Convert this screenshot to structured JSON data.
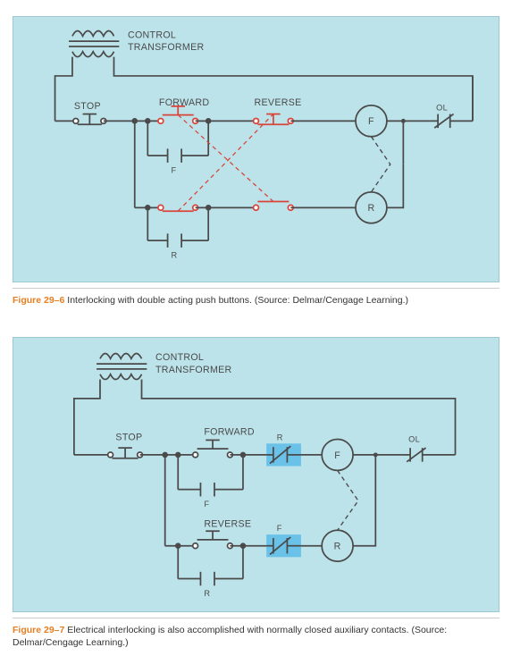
{
  "fig1": {
    "panel_bg": "#bce3ea",
    "transformer_label1": "CONTROL",
    "transformer_label2": "TRANSFORMER",
    "stop": "STOP",
    "forward": "FORWARD",
    "reverse": "REVERSE",
    "ol": "OL",
    "coil_f": "F",
    "coil_r": "R",
    "aux_f": "F",
    "aux_r": "R",
    "caption_no": "Figure 29–6",
    "caption_text": " Interlocking with double acting push buttons. (Source: Delmar/Cengage Learning.)"
  },
  "fig2": {
    "transformer_label1": "CONTROL",
    "transformer_label2": "TRANSFORMER",
    "stop": "STOP",
    "forward": "FORWARD",
    "reverse": "REVERSE",
    "ol": "OL",
    "coil_f": "F",
    "coil_r": "R",
    "aux_f": "F",
    "aux_r": "R",
    "nc_r": "R",
    "nc_f": "F",
    "caption_no": "Figure 29–7",
    "caption_text": " Electrical interlocking is also accomplished with normally closed auxiliary contacts. (Source: Delmar/Cengage Learning.)"
  },
  "chart_data": [
    {
      "type": "diagram",
      "title": "Figure 29-6 – Interlocking with double acting push buttons",
      "components": [
        {
          "name": "Control Transformer",
          "role": "supply"
        },
        {
          "name": "STOP",
          "type": "NC pushbutton"
        },
        {
          "name": "FORWARD",
          "type": "double-acting pushbutton",
          "contacts": [
            "NO (row1)",
            "NC (row2)"
          ]
        },
        {
          "name": "REVERSE",
          "type": "double-acting pushbutton",
          "contacts": [
            "NC (row1)",
            "NO (row2)"
          ]
        },
        {
          "name": "F coil",
          "type": "contactor coil"
        },
        {
          "name": "R coil",
          "type": "contactor coil"
        },
        {
          "name": "F aux NO",
          "type": "holding contact",
          "parallel_with": "FORWARD NO"
        },
        {
          "name": "R aux NO",
          "type": "holding contact",
          "parallel_with": "REVERSE NO"
        },
        {
          "name": "OL",
          "type": "NC overload contact"
        },
        {
          "name": "Mechanical interlock",
          "between": [
            "F coil",
            "R coil"
          ]
        }
      ],
      "rungs": [
        "L1 – STOP(NC) – FORWARD(NO) – REVERSE(NC) – F coil – OL(NC) – L2",
        "L1 – STOP(NC) – FORWARD(NC) – REVERSE(NO) – R coil – OL(NC) – L2"
      ]
    },
    {
      "type": "diagram",
      "title": "Figure 29-7 – Electrical interlocking with NC auxiliary contacts",
      "components": [
        {
          "name": "Control Transformer",
          "role": "supply"
        },
        {
          "name": "STOP",
          "type": "NC pushbutton"
        },
        {
          "name": "FORWARD",
          "type": "NO pushbutton"
        },
        {
          "name": "REVERSE",
          "type": "NO pushbutton"
        },
        {
          "name": "R NC aux",
          "type": "NC contact",
          "in_series_with": "F coil"
        },
        {
          "name": "F NC aux",
          "type": "NC contact",
          "in_series_with": "R coil"
        },
        {
          "name": "F coil",
          "type": "contactor coil"
        },
        {
          "name": "R coil",
          "type": "contactor coil"
        },
        {
          "name": "F aux NO",
          "type": "holding contact",
          "parallel_with": "FORWARD"
        },
        {
          "name": "R aux NO",
          "type": "holding contact",
          "parallel_with": "REVERSE"
        },
        {
          "name": "OL",
          "type": "NC overload contact"
        },
        {
          "name": "Mechanical interlock",
          "between": [
            "F coil",
            "R coil"
          ]
        }
      ],
      "rungs": [
        "L1 – STOP(NC) – FORWARD(NO) – R(NC) – F coil – OL(NC) – L2",
        "L1 – STOP(NC) – REVERSE(NO) – F(NC) – R coil – OL(NC) – L2"
      ]
    }
  ]
}
